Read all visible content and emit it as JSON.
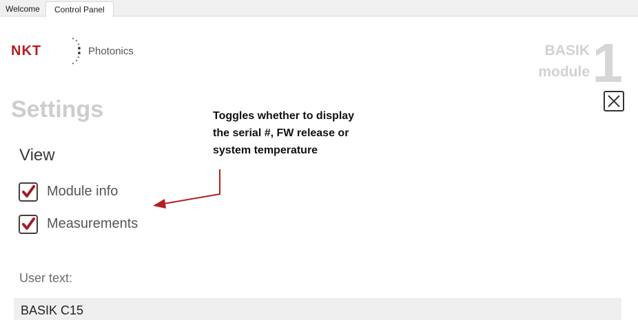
{
  "tabs": [
    {
      "label": "Welcome",
      "active": false
    },
    {
      "label": "Control Panel",
      "active": true
    }
  ],
  "logo": {
    "brand": "NKT",
    "tagline": "Photonics",
    "brand_color": "#b21e24"
  },
  "module_badge": {
    "line1": "BASIK",
    "line2": "module",
    "number": "1"
  },
  "close_icon": "close-x-icon",
  "settings_title": "Settings",
  "annotation": {
    "lines": [
      "Toggles whether to display",
      "the serial #, FW release or",
      "system temperature"
    ],
    "arrow_color": "#b21e24"
  },
  "view": {
    "heading": "View",
    "options": [
      {
        "label": "Module info",
        "checked": true
      },
      {
        "label": "Measurements",
        "checked": true
      }
    ],
    "check_color": "#a01c2c"
  },
  "user_text": {
    "label": "User text:",
    "value": "BASIK C15"
  }
}
